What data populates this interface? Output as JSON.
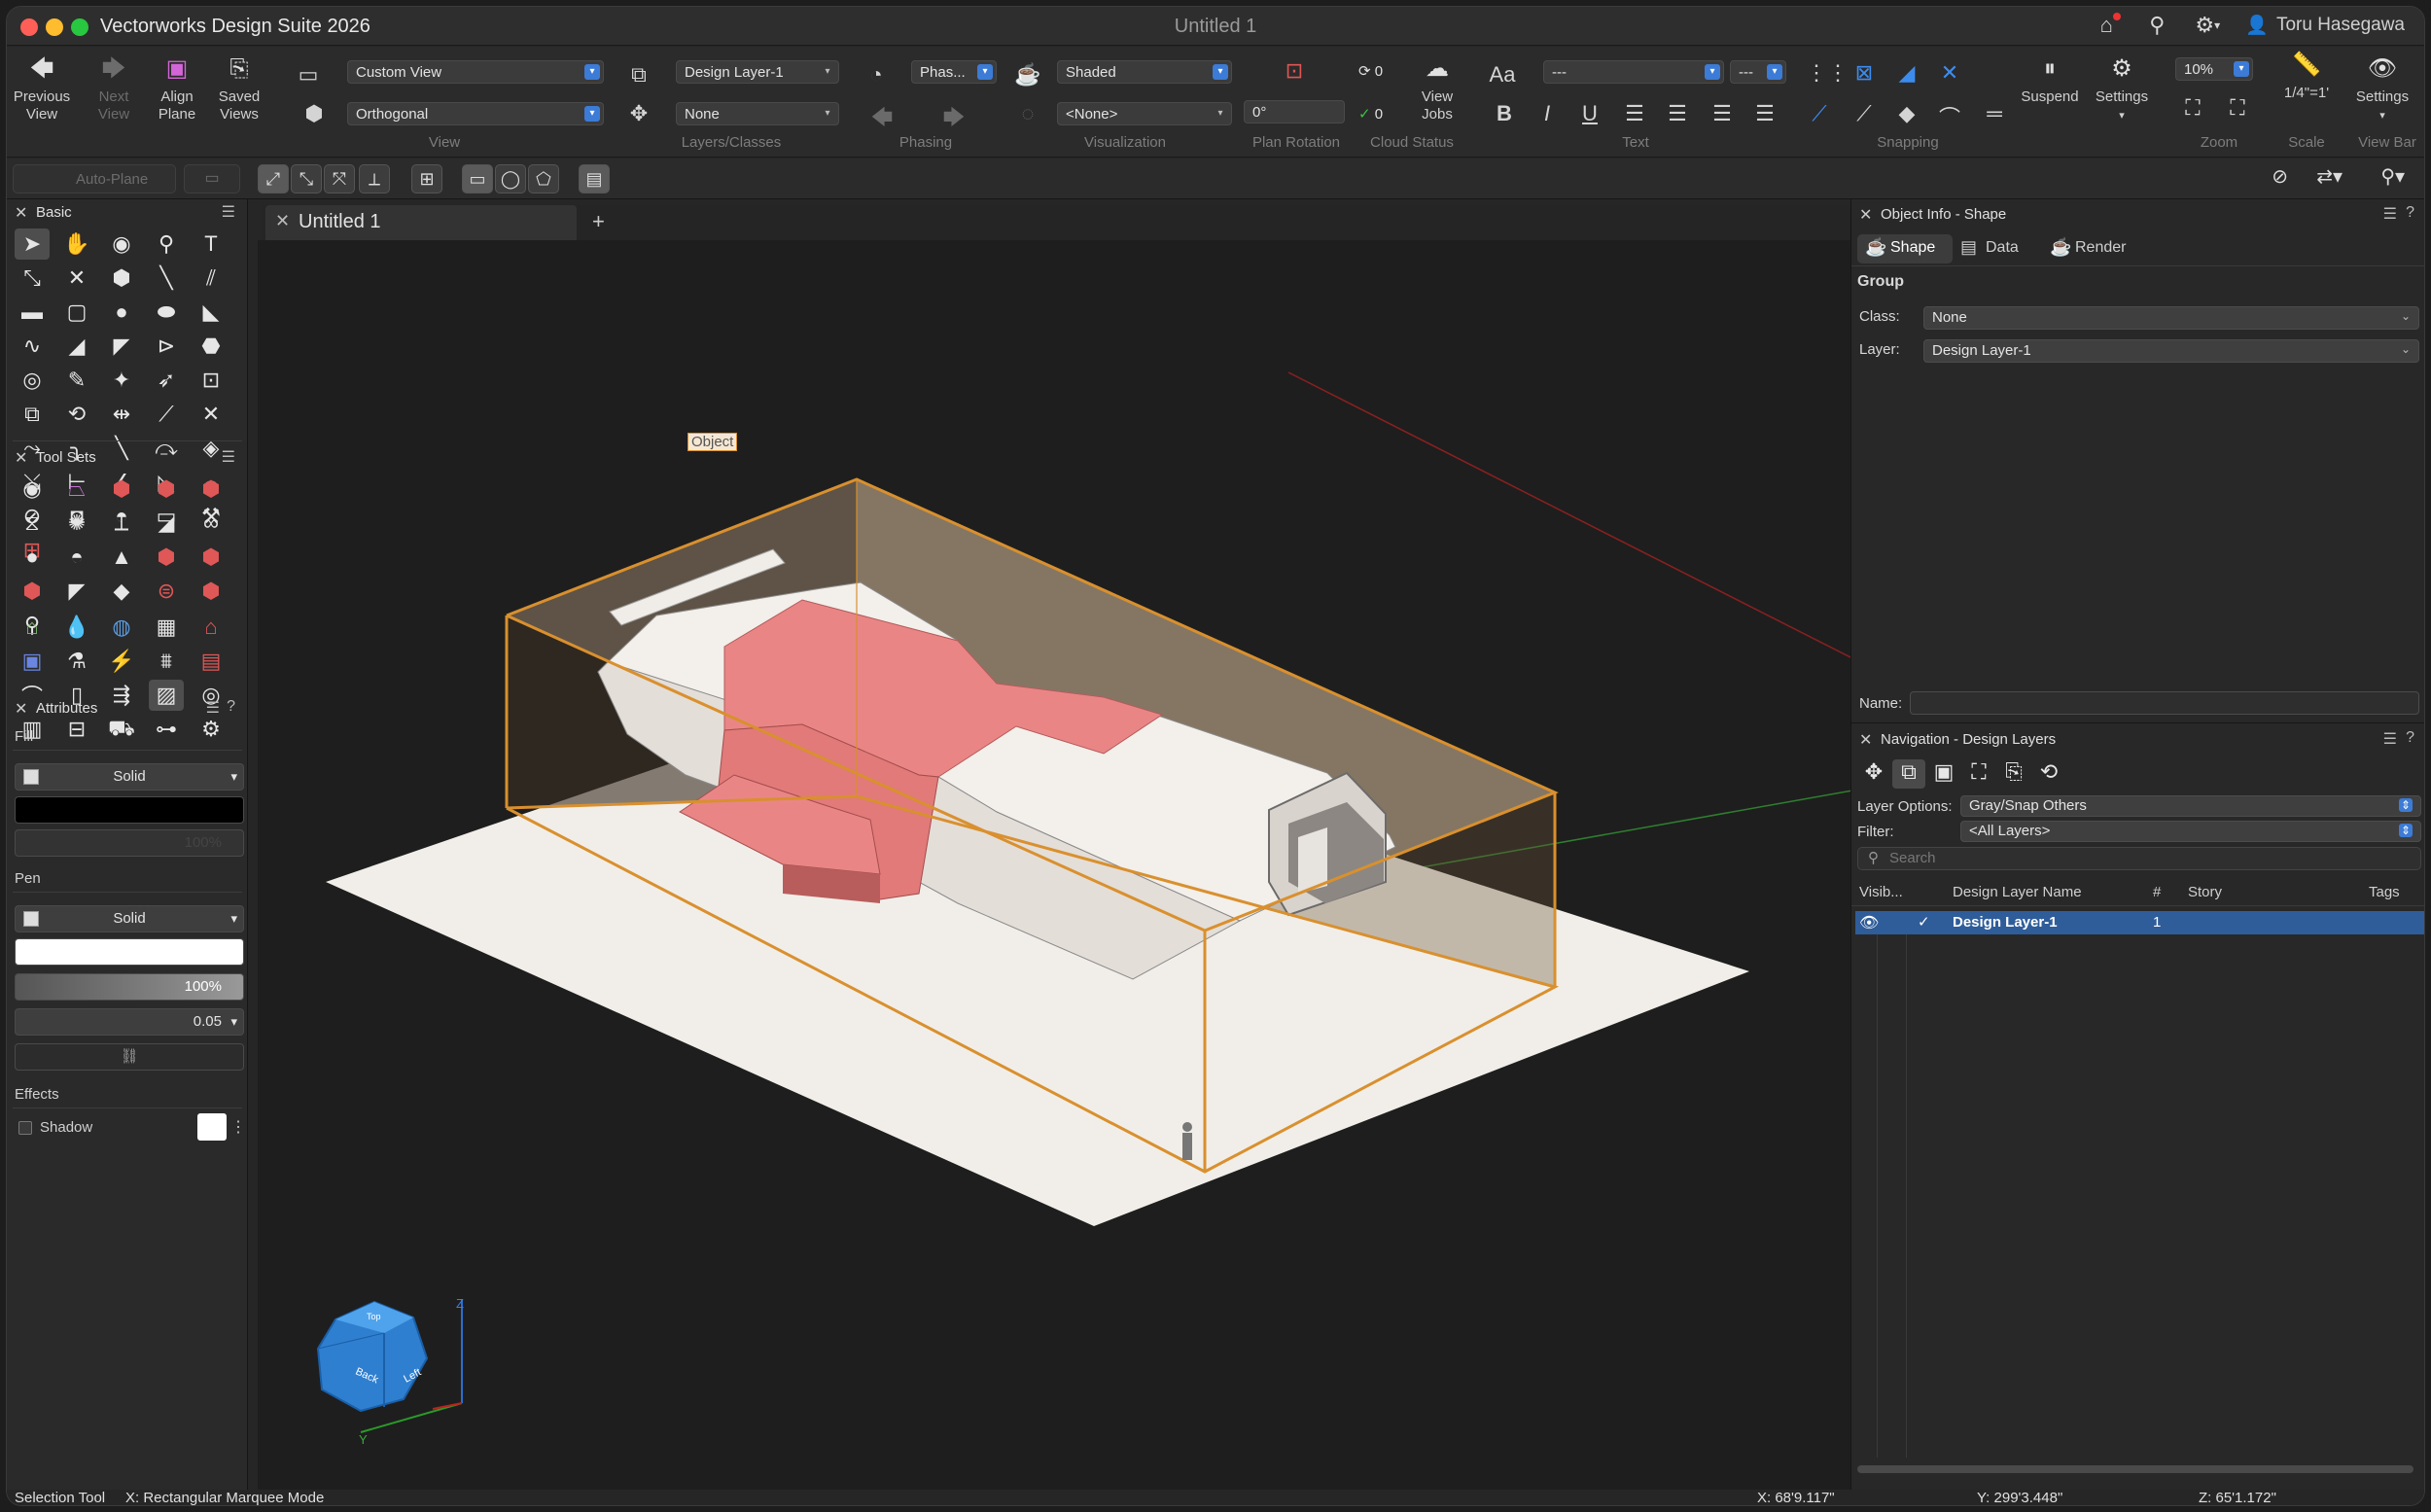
{
  "window": {
    "app_title": "Vectorworks Design Suite 2026",
    "doc_title": "Untitled 1",
    "user": "Toru Hasegawa"
  },
  "toolbar": {
    "previous_view": "Previous View",
    "next_view": "Next View",
    "align_plane": "Align Plane",
    "saved_views": "Saved Views",
    "view_dd": "Custom View",
    "projection_dd": "Orthogonal",
    "view_label": "View",
    "layer_dd": "Design Layer-1",
    "class_dd": "None",
    "layers_classes_label": "Layers/Classes",
    "phase_dd": "Phas...",
    "phasing_label": "Phasing",
    "render_dd": "Shaded",
    "lighting_dd": "<None>",
    "visualization_label": "Visualization",
    "rotation_value": "0°",
    "plan_rotation_label": "Plan Rotation",
    "cloud_count_a": "0",
    "cloud_count_b": "0",
    "cloud_status_label": "Cloud Status",
    "view_jobs": "View Jobs",
    "font_dd": "---",
    "size_dd": "---",
    "text_label": "Text",
    "snapping_label": "Snapping",
    "suspend": "Suspend",
    "settings": "Settings",
    "zoom_value": "10%",
    "zoom_label": "Zoom",
    "scale_value": "1/4\"=1'",
    "scale_label": "Scale",
    "viewbar_settings": "Settings",
    "viewbar_label": "View Bar",
    "auto_plane": "Auto-Plane"
  },
  "palettes": {
    "basic": "Basic",
    "toolsets": "Tool Sets",
    "attributes": "Attributes",
    "fill_label": "Fill",
    "fill_style": "Solid",
    "fill_opacity": "100%",
    "pen_label": "Pen",
    "pen_style": "Solid",
    "pen_opacity": "100%",
    "pen_weight": "0.05",
    "effects_label": "Effects",
    "shadow_label": "Shadow"
  },
  "tabs": {
    "doc_tab": "Untitled 1",
    "add": "+"
  },
  "canvas": {
    "object_tag": "Object",
    "cube_back": "Back",
    "cube_left": "Left",
    "cube_top": "Top",
    "axis_z": "Z",
    "axis_y": "Y"
  },
  "object_info": {
    "title": "Object Info - Shape",
    "tab_shape": "Shape",
    "tab_data": "Data",
    "tab_render": "Render",
    "type": "Group",
    "class_label": "Class:",
    "class_value": "None",
    "layer_label": "Layer:",
    "layer_value": "Design Layer-1",
    "name_label": "Name:"
  },
  "navigation": {
    "title": "Navigation - Design Layers",
    "layer_options_label": "Layer Options:",
    "layer_options_value": "Gray/Snap Others",
    "filter_label": "Filter:",
    "filter_value": "<All Layers>",
    "search_placeholder": "Search",
    "col_visibility": "Visib...",
    "col_name": "Design Layer Name",
    "col_num": "#",
    "col_story": "Story",
    "col_tags": "Tags",
    "rows": [
      {
        "name": "Design Layer-1",
        "num": "1"
      }
    ]
  },
  "status": {
    "tool": "Selection Tool",
    "mode": "X:  Rectangular Marquee Mode",
    "x": "X: 68'9.117\"",
    "y": "Y: 299'3.448\"",
    "z": "Z: 65'1.172\""
  },
  "colors": {
    "accent_blue": "#3c7bd6",
    "selection_orange": "#d9902e",
    "object_red": "#e98685"
  }
}
